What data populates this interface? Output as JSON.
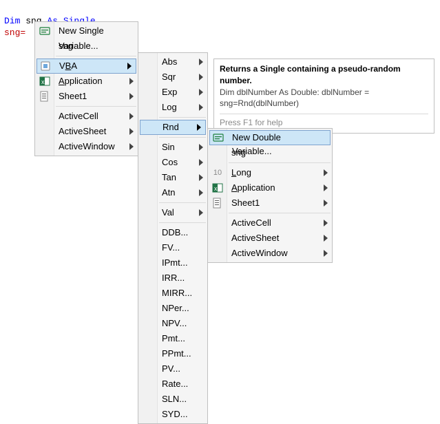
{
  "code": {
    "line1": {
      "kw1": "Dim",
      "var": " sng ",
      "kw2": "As Single"
    },
    "line2": "sng="
  },
  "menu1": {
    "newSingle": "New Single Variable...",
    "sng": "sng",
    "vba": {
      "text": "VBA",
      "u": "B"
    },
    "application": {
      "text": "Application",
      "u": "A"
    },
    "sheet1": "Sheet1",
    "activeCell": "ActiveCell",
    "activeSheet": "ActiveSheet",
    "activeWindow": "ActiveWindow"
  },
  "menu2": {
    "abs": "Abs",
    "sqr": "Sqr",
    "exp": "Exp",
    "log": "Log",
    "rnd": "Rnd",
    "sin": "Sin",
    "cos": "Cos",
    "tan": "Tan",
    "atn": "Atn",
    "val": "Val",
    "ddb": "DDB...",
    "fv": "FV...",
    "ipmt": "IPmt...",
    "irr": "IRR...",
    "mirr": "MIRR...",
    "nper": "NPer...",
    "npv": "NPV...",
    "pmt": "Pmt...",
    "ppmt": "PPmt...",
    "pv": "PV...",
    "rate": "Rate...",
    "sln": "SLN...",
    "syd": "SYD..."
  },
  "menu3": {
    "newDouble": "New Double Variable...",
    "sng": "sng",
    "long": {
      "text": "Long",
      "u": "L"
    },
    "application": {
      "text": "Application",
      "u": "A"
    },
    "sheet1": "Sheet1",
    "activeCell": "ActiveCell",
    "activeSheet": "ActiveSheet",
    "activeWindow": "ActiveWindow",
    "lineno": "10"
  },
  "tooltip": {
    "title": "Returns a Single containing a pseudo-random number.",
    "body1": "Dim dblNumber As Double: dblNumber =",
    "body2": "sng=Rnd(dblNumber)",
    "hint": "Press F1 for help"
  }
}
